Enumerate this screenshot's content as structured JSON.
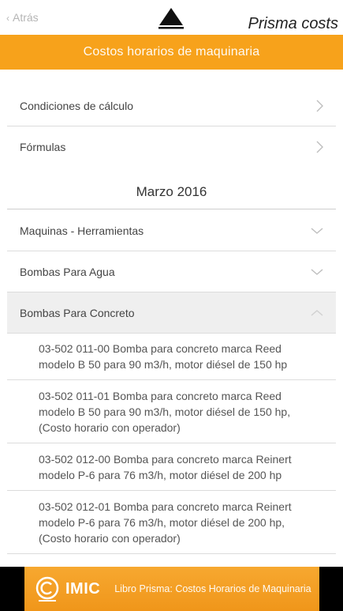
{
  "header": {
    "back_label": "Atrás",
    "brand_part1": "Prisma",
    "brand_part2": "costs"
  },
  "banner": {
    "title": "Costos horarios de maquinaria"
  },
  "top_items": [
    {
      "label": "Condiciones de cálculo",
      "icon": "chevron-right-icon"
    },
    {
      "label": "Fórmulas",
      "icon": "chevron-right-icon"
    }
  ],
  "section_date": "Marzo 2016",
  "categories": [
    {
      "label": "Maquinas - Herramientas",
      "icon": "chevron-down-icon",
      "expanded": false
    },
    {
      "label": "Bombas Para Agua",
      "icon": "chevron-down-icon",
      "expanded": false
    },
    {
      "label": "Bombas Para Concreto",
      "icon": "chevron-up-icon",
      "expanded": true
    }
  ],
  "subitems": [
    "03-502 011-00 Bomba para concreto marca Reed modelo B 50 para 90 m3/h, motor diésel de 150 hp",
    "03-502 011-01 Bomba para concreto marca Reed modelo B 50 para 90 m3/h, motor diésel de 150 hp, (Costo horario con operador)",
    "03-502 012-00 Bomba para concreto marca Reinert modelo P-6 para 76 m3/h, motor diésel de 200 hp",
    "03-502 012-01 Bomba para concreto marca Reinert modelo P-6 para 76 m3/h, motor diésel de 200 hp, (Costo horario con operador)"
  ],
  "footer_ad": {
    "logo_text": "IMIC",
    "text": "Libro Prisma: Costos Horarios de Maquinaria"
  },
  "colors": {
    "accent": "#f7a21b",
    "active_row": "#efefef",
    "divider": "#dcdcdc"
  }
}
